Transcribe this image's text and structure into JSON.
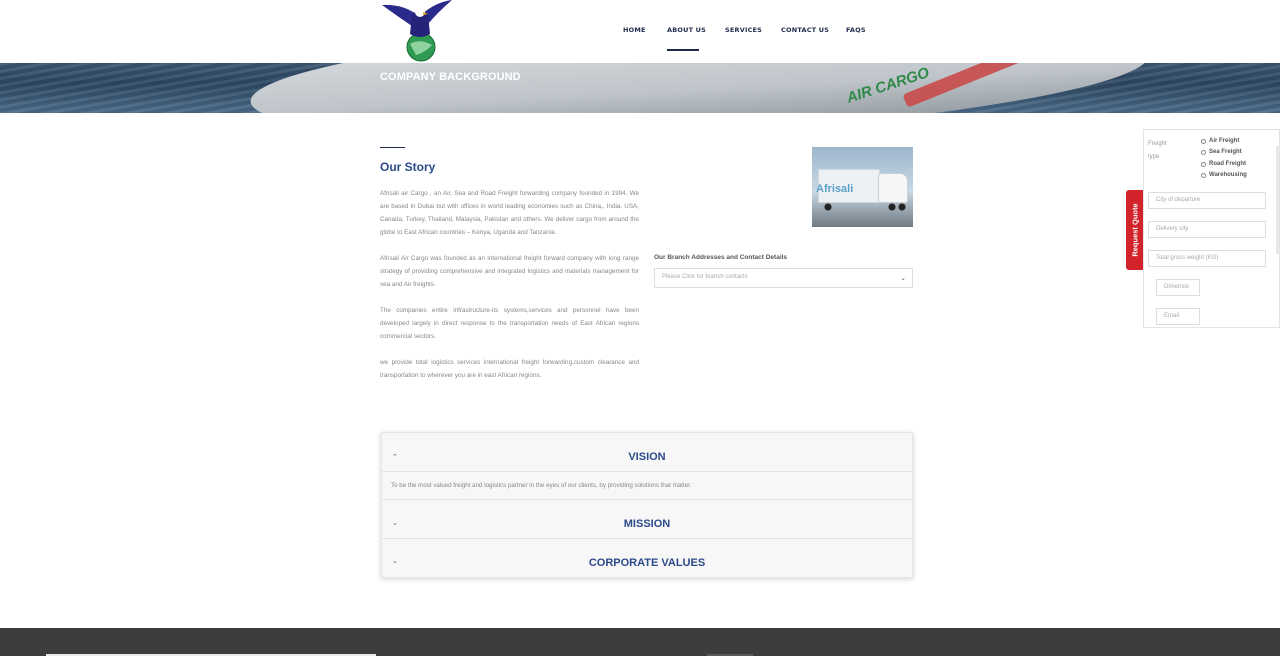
{
  "nav": {
    "items": [
      "HOME",
      "ABOUT US",
      "SERVICES",
      "CONTACT US",
      "FAQS"
    ],
    "active": "ABOUT US"
  },
  "banner": {
    "title": "COMPANY BACKGROUND",
    "ship_text": "AIR CARGO"
  },
  "story": {
    "title": "Our Story",
    "paragraphs": [
      "Afrisali air Cargo , an Air, Sea and Road Freight forwarding company founded in 1994. We are based in Dubai but with offices in world leading economies such as China,, India, USA, Canada, Turkey, Thailand, Malaysia, Pakistan and others.  We deliver cargo from around the globe to East African countries – Kenya, Uganda and Tanzania.",
      "Afrisali Air Cargo was founded as an international freight forward company with long range strategy of providing comprehensive and integrated logistics and materials management for sea and  Air freights.",
      "The companies entire infrastructure-its systems,services and personnel have been developed largely in direct response to the transportation needs of East African regions commercial sectors.",
      "we provide total logistics services international freight forwarding,custom clearance and transportation to wherever you are in east African regions."
    ],
    "truck_brand": "Afrisali"
  },
  "branch": {
    "label": "Our Branch Addresses and Contact Details",
    "placeholder": "Please Click for branch contacts"
  },
  "accordion": [
    {
      "title": "VISION",
      "body": "To be the most valued freight and logistics partner in the eyes of our clients, by providing solutions that matter.",
      "expanded": true
    },
    {
      "title": "MISSION",
      "body": "",
      "expanded": false
    },
    {
      "title": "CORPORATE VALUES",
      "body": "",
      "expanded": false
    }
  ],
  "quote": {
    "tab_label": "Request Quote",
    "freight_label_1": "Freight",
    "freight_label_2": "type",
    "options": [
      "Air Freight",
      "Sea Freight",
      "Road Freight",
      "Warehousing"
    ],
    "fields": {
      "departure": "City of departure",
      "delivery": "Delivery city",
      "weight": "Total gross weight (KG)",
      "dimension": "Dimensio",
      "email": "Email"
    }
  },
  "colors": {
    "navy": "#1e2a4a",
    "accent_blue": "#2c4a8a",
    "quote_red": "#d2232a",
    "footer": "#3d3d3d"
  }
}
